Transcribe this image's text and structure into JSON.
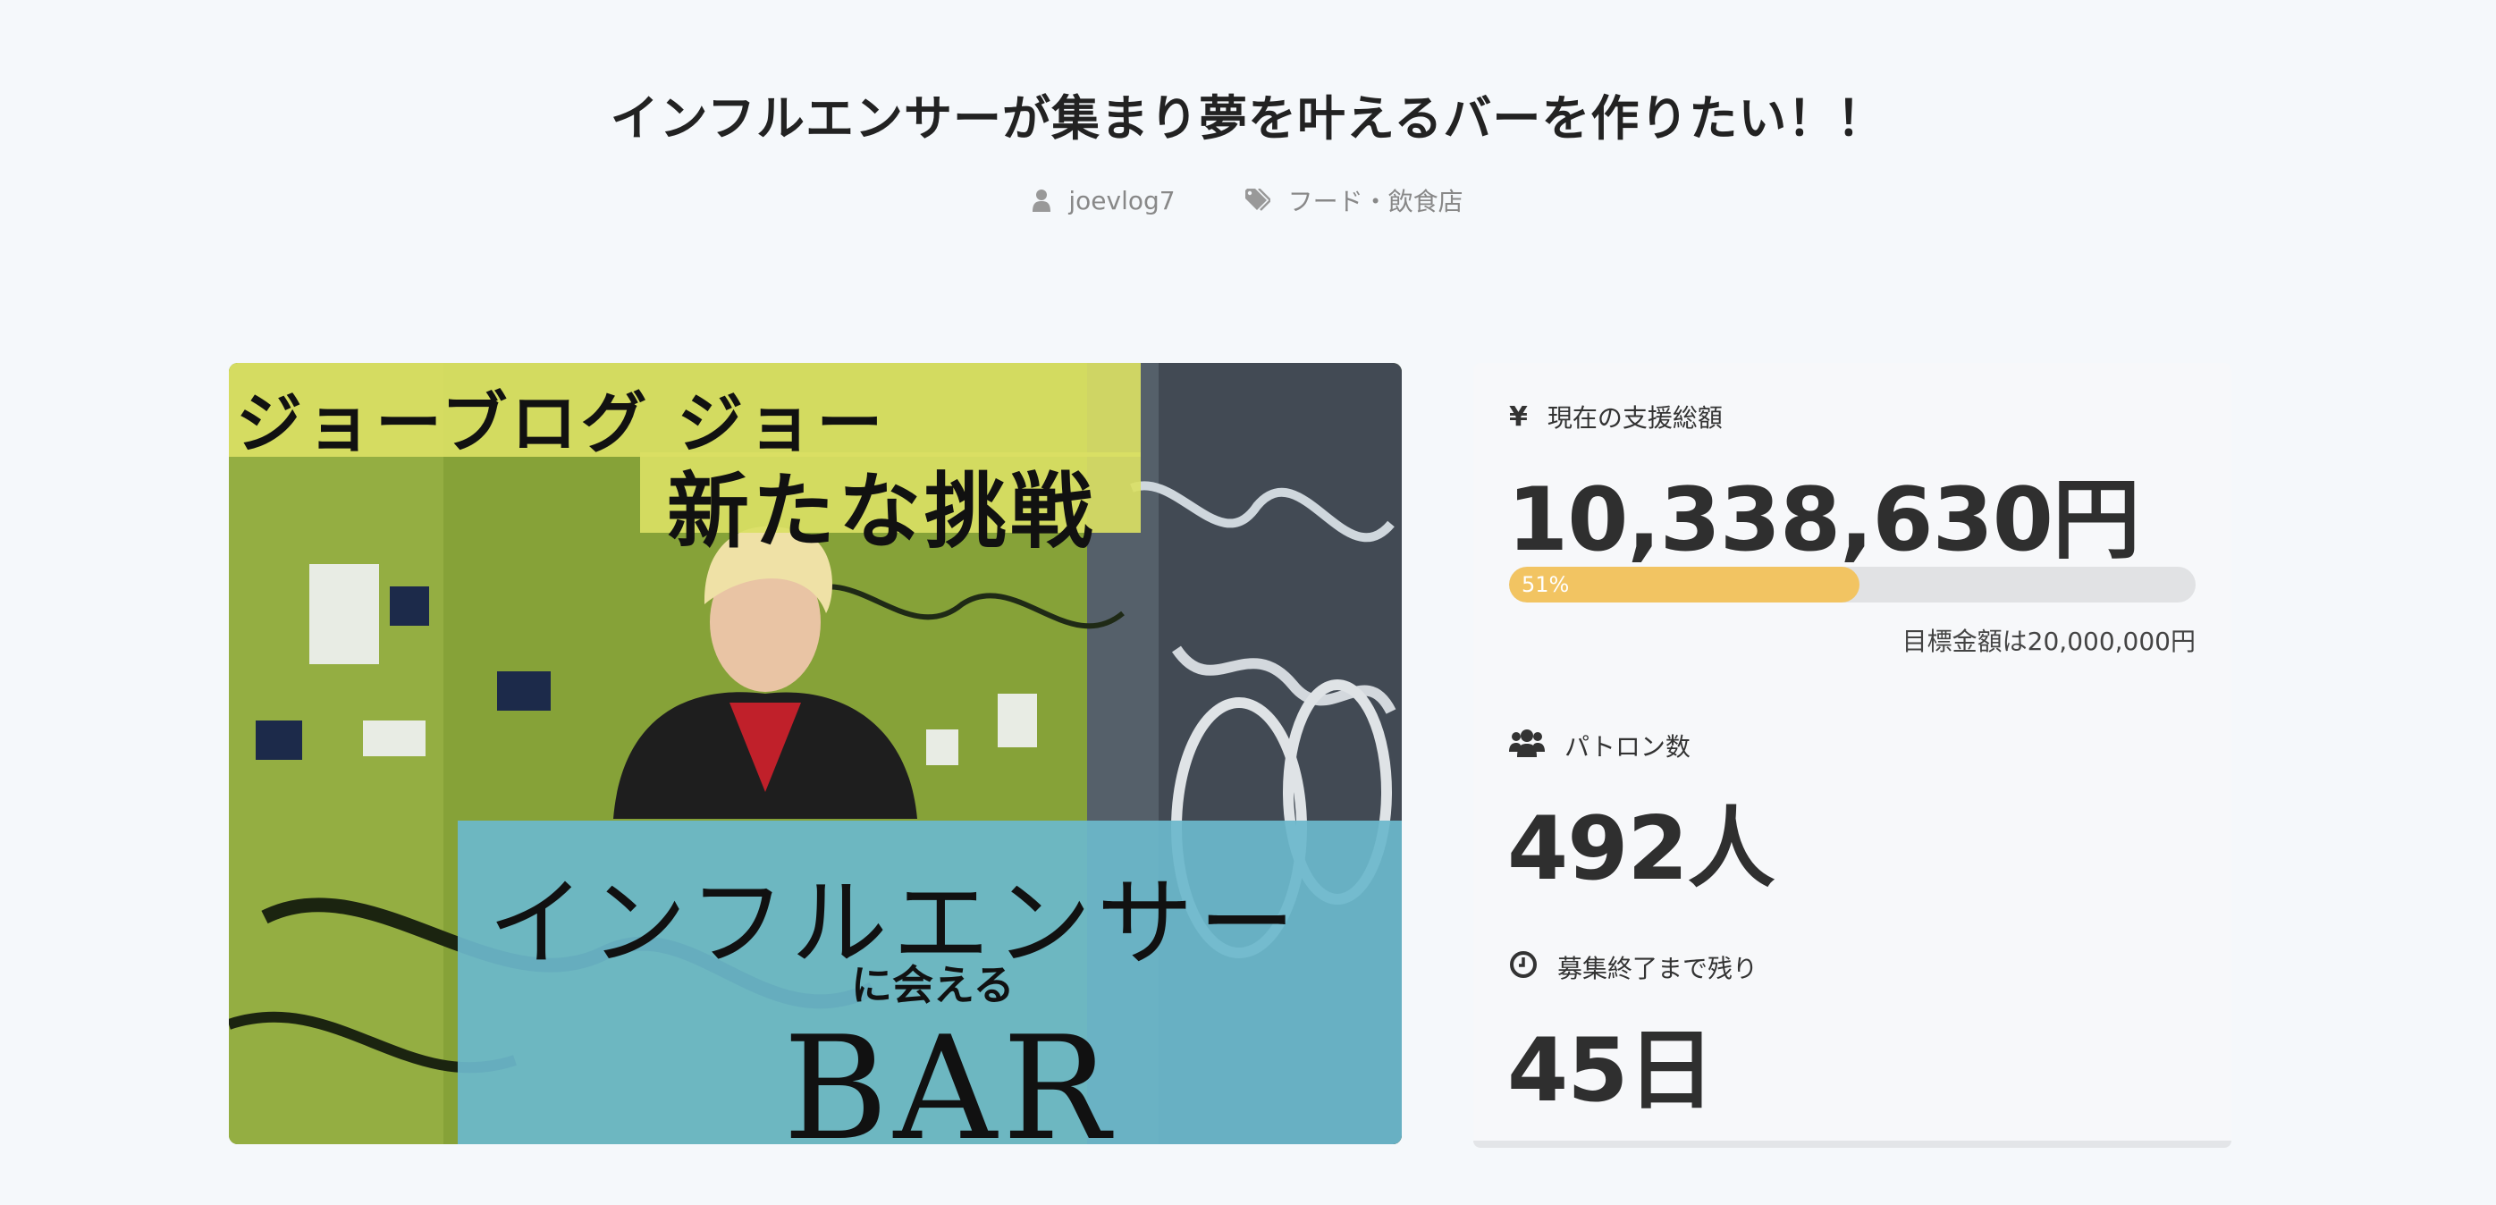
{
  "project": {
    "title": "インフルエンサーが集まり夢を叶えるバーを作りたい！！",
    "author": "joevlog7",
    "category": "フード・飲食店"
  },
  "icons": {
    "author": "user-icon",
    "category": "tag-icon",
    "amount": "yen-icon",
    "patrons": "users-icon",
    "deadline": "clock-icon"
  },
  "hero_image": {
    "line1": "ジョーブログ ジョー",
    "line2": "新たな挑戦",
    "line3": "インフルエンサー",
    "line4": "に会える",
    "line5": "BAR"
  },
  "stats": {
    "amount_label": "現在の支援総額",
    "amount_value": "10,338,630円",
    "progress_percent": 51,
    "progress_text": "51%",
    "goal_text": "目標金額は20,000,000円",
    "patrons_label": "パトロン数",
    "patrons_value": "492人",
    "remaining_label": "募集終了まで残り",
    "remaining_value": "45日"
  },
  "colors": {
    "background": "#f5f8fb",
    "progress_fill": "#f2c462",
    "progress_track": "#e1e2e4",
    "hero_yellow": "#d8de62",
    "hero_blue": "#6ab7c9"
  }
}
